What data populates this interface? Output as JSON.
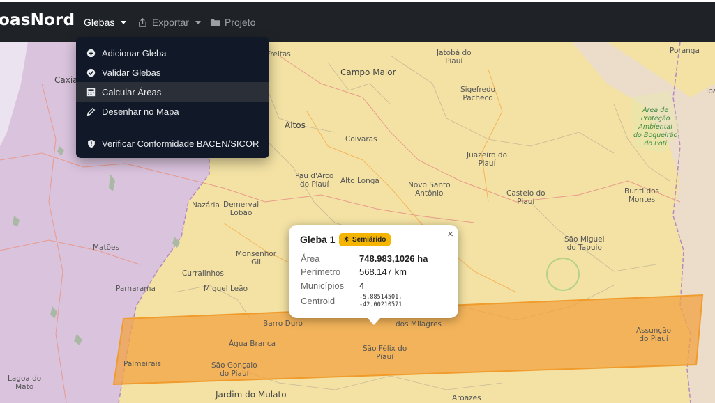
{
  "app": {
    "brand": "oasNord"
  },
  "nav": {
    "glebas": "Glebas",
    "exportar": "Exportar",
    "projeto": "Projeto"
  },
  "dropdown": {
    "items": [
      {
        "label": "Adicionar Gleba",
        "icon": "plus-circle-icon"
      },
      {
        "label": "Validar Glebas",
        "icon": "check-circle-icon"
      },
      {
        "label": "Calcular Áreas",
        "icon": "calculator-icon"
      },
      {
        "label": "Desenhar no Mapa",
        "icon": "pen-icon"
      },
      {
        "label": "Verificar Conformidade BACEN/SICOR",
        "icon": "shield-icon"
      }
    ],
    "active_index": 2
  },
  "popup": {
    "title": "Gleba 1",
    "badge": "Semiárido",
    "badge_color": "#f4b400",
    "rows": [
      {
        "label": "Área",
        "value": "748.983,1026 ha"
      },
      {
        "label": "Perímetro",
        "value": "568.147 km"
      },
      {
        "label": "Municípios",
        "value": "4"
      },
      {
        "label": "Centroid",
        "lat": "-5.88514501,",
        "lon": "-42.00210571"
      }
    ],
    "close": "×"
  },
  "map": {
    "polygon_color": "#f2a341",
    "places": [
      "Freitas",
      "Jatobá do\nPiauí",
      "Campo Maior",
      "Sigefredo\nPacheco",
      "Poranga",
      "Caxia",
      "Área de\nProteção\nAmbiental\ndo Boqueirão\ndo Poti",
      "Altos",
      "Coivaras",
      "Juazeiro do\nPiauí",
      "Pau d'Arco\ndo Piauí",
      "Alto Longá",
      "Novo Santo\nAntônio",
      "Castelo do\nPiauí",
      "Buriti dos\nMontes",
      "Nazária",
      "Demerval\nLobão",
      "Matões",
      "São Miguel\ndo Tapuio",
      "Monsenhor\nGil",
      "Curralinhos",
      "Parnarama",
      "Miguel Leão",
      "Barro Duro",
      "dos Milagres",
      "Água Branca",
      "São Félix do\nPiauí",
      "Assunção\ndo Piauí",
      "Palmeirais",
      "São Gonçalo\ndo Piauí",
      "Lagoa do\nMato",
      "Jardim do Mulato",
      "Aroazes",
      "Ipa"
    ]
  }
}
